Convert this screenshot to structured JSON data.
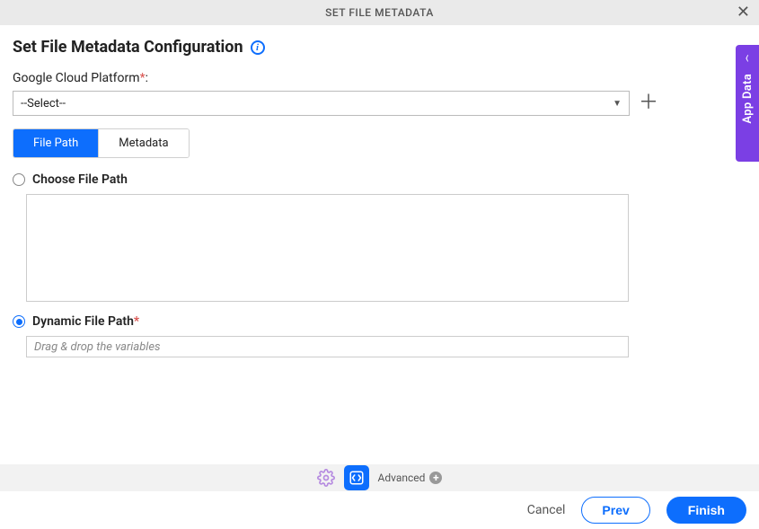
{
  "header": {
    "title": "SET FILE METADATA"
  },
  "section": {
    "title": "Set File Metadata Configuration"
  },
  "gcp": {
    "label_text": "Google Cloud Platform",
    "required_mark": "*",
    "colon": ":",
    "selected": "--Select--"
  },
  "tabs": {
    "file_path": "File Path",
    "metadata": "Metadata"
  },
  "choose_file": {
    "label": "Choose File Path"
  },
  "dynamic_file": {
    "label_text": "Dynamic File Path",
    "required_mark": "*",
    "placeholder": "Drag & drop the variables"
  },
  "side_tab": {
    "label": "App Data"
  },
  "toolbar_bottom": {
    "advanced": "Advanced"
  },
  "footer": {
    "cancel": "Cancel",
    "prev": "Prev",
    "finish": "Finish"
  }
}
